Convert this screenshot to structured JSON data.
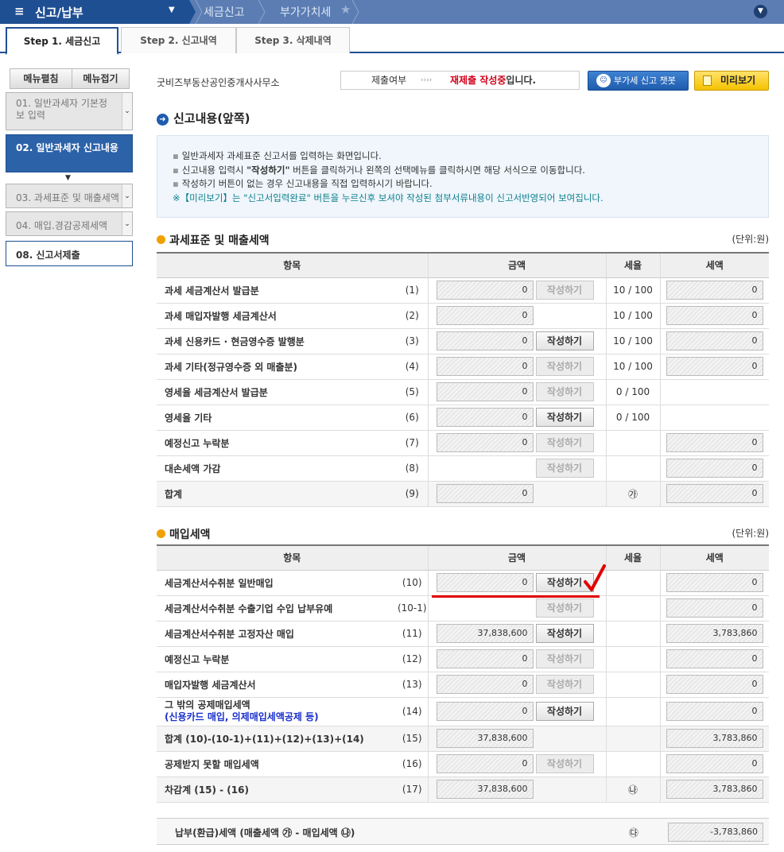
{
  "topbar": {
    "menu_icon": "≡",
    "title": "신고/납부",
    "crumb1": "세금신고",
    "crumb2": "부가가치세"
  },
  "tabs": [
    "Step 1. 세금신고",
    "Step 2. 신고내역",
    "Step 3. 삭제내역"
  ],
  "sidebar": {
    "expand_label": "메뉴펼침",
    "collapse_label": "메뉴접기",
    "items": [
      {
        "label": "01. 일반과세자 기본정보 입력"
      },
      {
        "label": "02. 일반과세자 신고내용"
      },
      {
        "label": "03. 과세표준 및 매출세액"
      },
      {
        "label": "04. 매입.경감공제세액"
      },
      {
        "label": "08. 신고서제출"
      }
    ]
  },
  "header": {
    "company": "굿비즈부동산공인중개사사무소",
    "status_label": "제출여부",
    "status_arrows": "›››› ",
    "status_value": "재제출 작성중",
    "status_suffix": "입니다.",
    "chatbot_label": "부가세 신고 챗봇",
    "preview_label": "미리보기"
  },
  "section": {
    "title": "신고내용(앞쪽)"
  },
  "info": {
    "line1": "일반과세자 과세표준 신고서를 입력하는 화면입니다.",
    "line2_pre": "신고내용 입력시 ",
    "line2_bold": "\"작성하기\"",
    "line2_post": " 버튼을 클릭하거나 왼쪽의 선택메뉴를 클릭하시면 해당 서식으로 이동합니다.",
    "line3": "작성하기 버튼이 없는 경우 신고내용을 직접 입력하시기 바랍니다.",
    "line4": "※【미리보기】는 \"신고서입력완료\" 버튼을 누르신후 보셔야 작성된 첨부서류내용이 신고서반영되어 보여집니다."
  },
  "write_label": "작성하기",
  "sales": {
    "title": "과세표준 및 매출세액",
    "unit": "(단위:원)",
    "headers": [
      "항목",
      "금액",
      "세율",
      "세액"
    ],
    "rows": [
      {
        "label": "과세 세금계산서 발급분",
        "no": "(1)",
        "amount": "0",
        "btn": "disabled",
        "rate": "10 / 100",
        "tax": "0"
      },
      {
        "label": "과세 매입자발행 세금계산서",
        "no": "(2)",
        "amount": "0",
        "btn": "",
        "rate": "10 / 100",
        "tax": "0"
      },
      {
        "label": "과세 신용카드 · 현금영수증 발행분",
        "no": "(3)",
        "amount": "0",
        "btn": "on",
        "rate": "10 / 100",
        "tax": "0"
      },
      {
        "label": "과세 기타(정규영수증 외 매출분)",
        "no": "(4)",
        "amount": "0",
        "btn": "disabled",
        "rate": "10 / 100",
        "tax": "0"
      },
      {
        "label": "영세율 세금계산서 발급분",
        "no": "(5)",
        "amount": "0",
        "btn": "disabled",
        "rate": "0 / 100",
        "tax": ""
      },
      {
        "label": "영세율 기타",
        "no": "(6)",
        "amount": "0",
        "btn": "on",
        "rate": "0 / 100",
        "tax": ""
      },
      {
        "label": "예정신고 누락분",
        "no": "(7)",
        "amount": "0",
        "btn": "disabled",
        "rate": "",
        "tax": "0"
      },
      {
        "label": "대손세액 가감",
        "no": "(8)",
        "amount": "",
        "btn": "disabled",
        "rate": "",
        "tax": "0"
      },
      {
        "label": "합계",
        "no": "(9)",
        "amount": "0",
        "btn": "",
        "rate": "㉮",
        "tax": "0",
        "sum": true
      }
    ]
  },
  "purchase": {
    "title": "매입세액",
    "unit": "(단위:원)",
    "headers": [
      "항목",
      "금액",
      "세율",
      "세액"
    ],
    "rows": [
      {
        "label": "세금계산서수취분 일반매입",
        "no": "(10)",
        "amount": "0",
        "btn": "on",
        "rate": "",
        "tax": "0"
      },
      {
        "label": "세금계산서수취분 수출기업 수입 납부유예",
        "no": "(10-1)",
        "amount": "",
        "btn": "disabled",
        "rate": "",
        "tax": "0"
      },
      {
        "label": "세금계산서수취분 고정자산 매입",
        "no": "(11)",
        "amount": "37,838,600",
        "btn": "on",
        "rate": "",
        "tax": "3,783,860"
      },
      {
        "label": "예정신고 누락분",
        "no": "(12)",
        "amount": "0",
        "btn": "disabled",
        "rate": "",
        "tax": "0"
      },
      {
        "label": "매입자발행 세금계산서",
        "no": "(13)",
        "amount": "0",
        "btn": "disabled",
        "rate": "",
        "tax": "0"
      },
      {
        "label": "그 밖의 공제매입세액",
        "sub": "(신용카드 매입, 의제매입세액공제 등)",
        "no": "(14)",
        "amount": "0",
        "btn": "on",
        "rate": "",
        "tax": "0"
      },
      {
        "label": "합계 (10)-(10-1)+(11)+(12)+(13)+(14)",
        "no": "(15)",
        "amount": "37,838,600",
        "btn": "",
        "rate": "",
        "tax": "3,783,860",
        "sum": true
      },
      {
        "label": "공제받지 못할 매입세액",
        "no": "(16)",
        "amount": "0",
        "btn": "disabled",
        "rate": "",
        "tax": "0"
      },
      {
        "label": "차감계 (15) - (16)",
        "no": "(17)",
        "amount": "37,838,600",
        "btn": "",
        "rate": "㉯",
        "tax": "3,783,860",
        "sum": true
      }
    ]
  },
  "final": {
    "label": "납부(환급)세액 (매출세액 ㉮ - 매입세액 ㉯)",
    "mark": "㉰",
    "value": "-3,783,860"
  },
  "colors": {
    "brand": "#1f4f93",
    "highlight": "#d0021b",
    "chatbot": "#1f5cae",
    "preview": "#f5c200"
  }
}
